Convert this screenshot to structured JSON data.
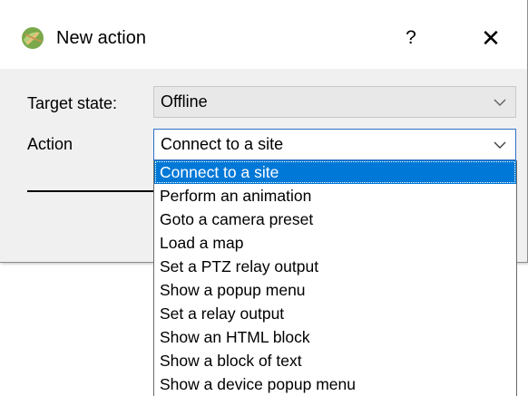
{
  "window": {
    "title": "New action",
    "help_label": "?",
    "close_label": "✕"
  },
  "form": {
    "target_state_label": "Target state:",
    "target_state_value": "Offline",
    "action_label": "Action",
    "action_value": "Connect to a site"
  },
  "dropdown": {
    "options": [
      {
        "label": "Connect to a site",
        "selected": true
      },
      {
        "label": "Perform an animation",
        "selected": false
      },
      {
        "label": "Goto a camera preset",
        "selected": false
      },
      {
        "label": "Load a map",
        "selected": false
      },
      {
        "label": "Set a PTZ relay output",
        "selected": false
      },
      {
        "label": "Show a popup menu",
        "selected": false
      },
      {
        "label": "Set a relay output",
        "selected": false
      },
      {
        "label": "Show an HTML block",
        "selected": false
      },
      {
        "label": "Show a block of text",
        "selected": false
      },
      {
        "label": "Show a device popup menu",
        "selected": false
      }
    ]
  },
  "colors": {
    "selection": "#0078d7",
    "combo_focus_border": "#2f6fc4"
  }
}
